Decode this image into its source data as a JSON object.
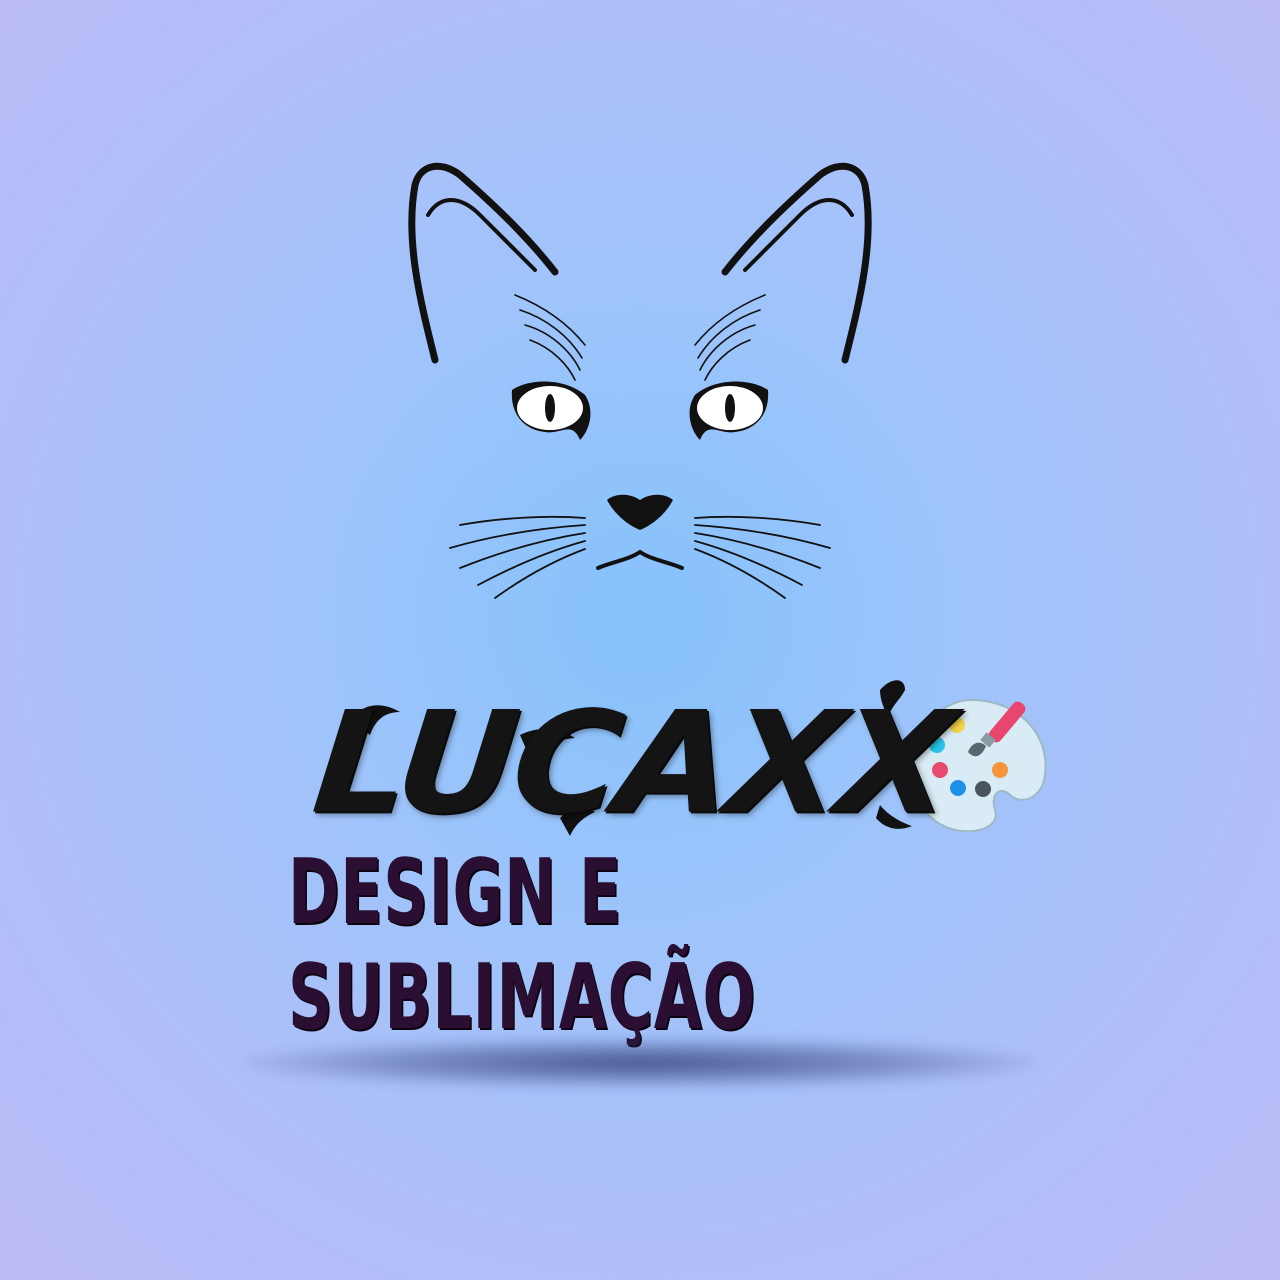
{
  "brand": {
    "name": "LUCAXX",
    "tagline": "DESIGN E SUBLIMAÇÃO"
  },
  "icons": {
    "mascot": "cat-face-icon",
    "palette": "paint-palette-icon"
  },
  "colors": {
    "background_center": "#86c2fb",
    "background_edge": "#bcbaf6",
    "brand_text": "#141414",
    "tagline_text": "#2a0f33",
    "brush_handle": "#e8456f",
    "palette_body": "#d9ecf5"
  }
}
